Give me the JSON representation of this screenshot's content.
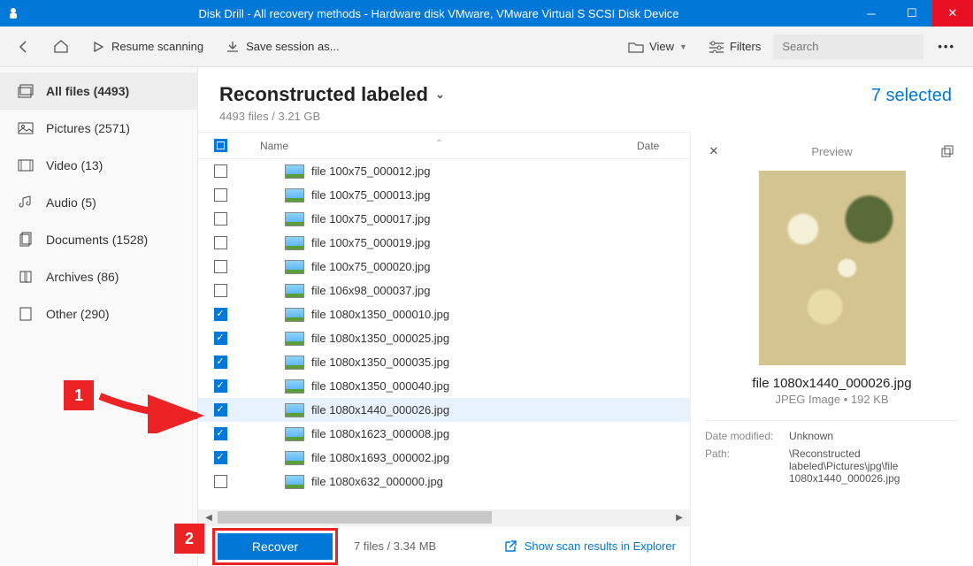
{
  "window": {
    "title": "Disk Drill - All recovery methods - Hardware disk VMware, VMware Virtual S SCSI Disk Device"
  },
  "toolbar": {
    "resume": "Resume scanning",
    "save_session": "Save session as...",
    "view": "View",
    "filters": "Filters",
    "search_placeholder": "Search"
  },
  "sidebar": {
    "items": [
      {
        "label": "All files (4493)"
      },
      {
        "label": "Pictures (2571)"
      },
      {
        "label": "Video (13)"
      },
      {
        "label": "Audio (5)"
      },
      {
        "label": "Documents (1528)"
      },
      {
        "label": "Archives (86)"
      },
      {
        "label": "Other (290)"
      }
    ]
  },
  "header": {
    "title": "Reconstructed labeled",
    "subtitle": "4493 files / 3.21 GB",
    "selected": "7 selected"
  },
  "columns": {
    "name": "Name",
    "date": "Date"
  },
  "files": [
    {
      "checked": false,
      "name": "file 100x75_000012.jpg"
    },
    {
      "checked": false,
      "name": "file 100x75_000013.jpg"
    },
    {
      "checked": false,
      "name": "file 100x75_000017.jpg"
    },
    {
      "checked": false,
      "name": "file 100x75_000019.jpg"
    },
    {
      "checked": false,
      "name": "file 100x75_000020.jpg"
    },
    {
      "checked": false,
      "name": "file 106x98_000037.jpg"
    },
    {
      "checked": true,
      "name": "file 1080x1350_000010.jpg"
    },
    {
      "checked": true,
      "name": "file 1080x1350_000025.jpg"
    },
    {
      "checked": true,
      "name": "file 1080x1350_000035.jpg"
    },
    {
      "checked": true,
      "name": "file 1080x1350_000040.jpg"
    },
    {
      "checked": true,
      "name": "file 1080x1440_000026.jpg",
      "selected": true
    },
    {
      "checked": true,
      "name": "file 1080x1623_000008.jpg"
    },
    {
      "checked": true,
      "name": "file 1080x1693_000002.jpg"
    },
    {
      "checked": false,
      "name": "file 1080x632_000000.jpg"
    }
  ],
  "footer": {
    "recover": "Recover",
    "summary": "7 files / 3.34 MB",
    "explorer": "Show scan results in Explorer"
  },
  "preview": {
    "title": "Preview",
    "filename": "file 1080x1440_000026.jpg",
    "meta": "JPEG Image • 192 KB",
    "date_label": "Date modified:",
    "date_value": "Unknown",
    "path_label": "Path:",
    "path_value": "\\Reconstructed labeled\\Pictures\\jpg\\file 1080x1440_000026.jpg"
  },
  "callouts": {
    "one": "1",
    "two": "2"
  }
}
